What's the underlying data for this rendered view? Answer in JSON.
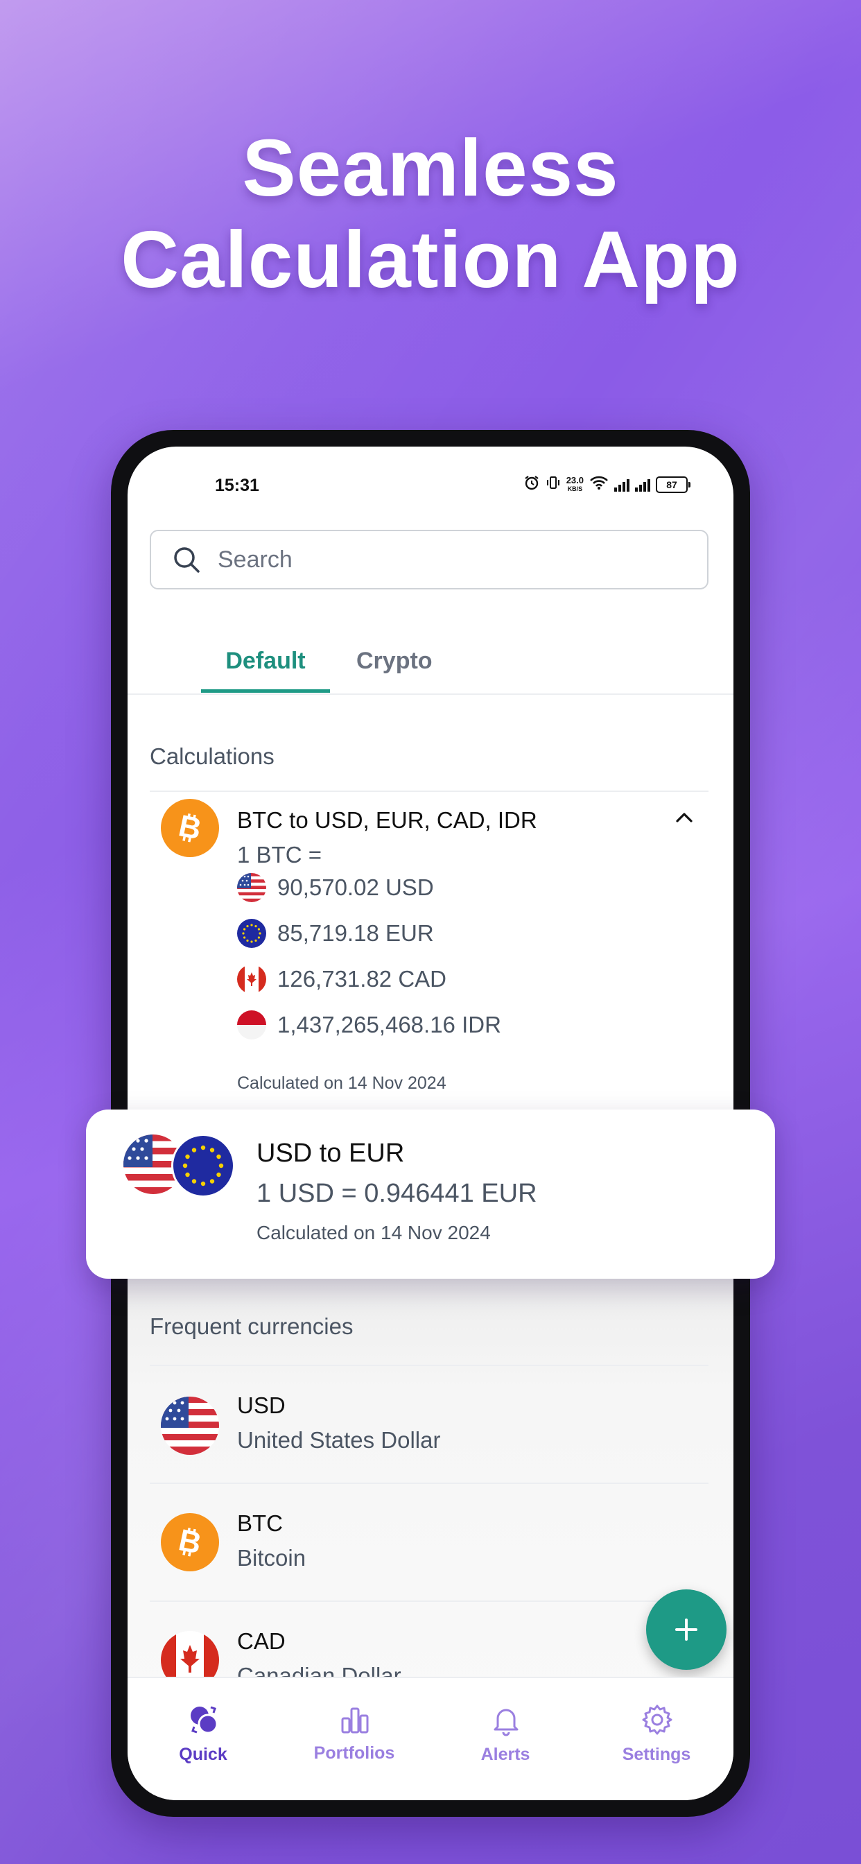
{
  "headline": {
    "line1": "Seamless",
    "line2": "Calculation App"
  },
  "status_bar": {
    "time": "15:31",
    "net_speed_value": "23.0",
    "net_speed_unit": "KB/S",
    "battery": "87"
  },
  "search": {
    "placeholder": "Search"
  },
  "tabs": [
    {
      "label": "Default",
      "active": true
    },
    {
      "label": "Crypto",
      "active": false
    }
  ],
  "calculations": {
    "section_title": "Calculations",
    "item": {
      "title": "BTC to USD, EUR, CAD, IDR",
      "base": "1 BTC =",
      "conversions": [
        {
          "flag": "us-flag-icon",
          "text": "90,570.02 USD"
        },
        {
          "flag": "eu-flag-icon",
          "text": "85,719.18 EUR"
        },
        {
          "flag": "ca-flag-icon",
          "text": "126,731.82 CAD"
        },
        {
          "flag": "id-flag-icon",
          "text": "1,437,265,468.16 IDR"
        }
      ],
      "date": "Calculated on 14 Nov 2024"
    }
  },
  "floating_card": {
    "title": "USD to EUR",
    "rate": "1 USD = 0.946441 EUR",
    "date": "Calculated on 14 Nov 2024"
  },
  "frequent": {
    "section_title": "Frequent currencies",
    "items": [
      {
        "code": "USD",
        "name": "United States Dollar"
      },
      {
        "code": "BTC",
        "name": "Bitcoin"
      },
      {
        "code": "CAD",
        "name": "Canadian Dollar"
      }
    ]
  },
  "fab": {
    "symbol": "+"
  },
  "bottom_nav": [
    {
      "label": "Quick",
      "icon": "coins-icon",
      "active": true
    },
    {
      "label": "Portfolios",
      "icon": "chart-bars-icon",
      "active": false
    },
    {
      "label": "Alerts",
      "icon": "bell-icon",
      "active": false
    },
    {
      "label": "Settings",
      "icon": "gear-icon",
      "active": false
    }
  ],
  "colors": {
    "accent_teal": "#1e9a86",
    "nav_active": "#5b3cc4",
    "nav_inactive": "#9a7fe0",
    "bitcoin_orange": "#f7931a",
    "background_purple": "#8a5ae6"
  }
}
